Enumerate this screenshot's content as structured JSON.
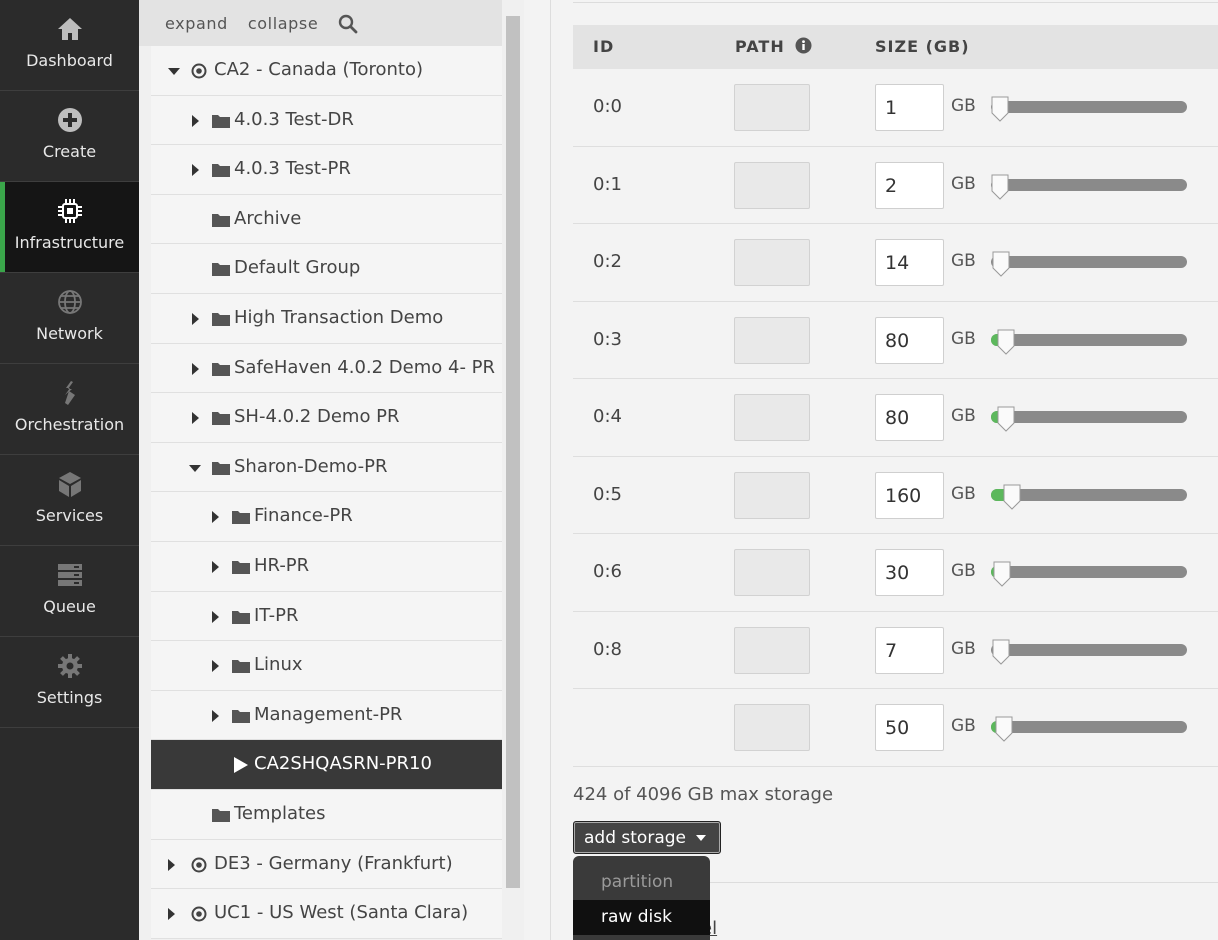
{
  "nav": {
    "items": [
      {
        "label": "Dashboard",
        "icon": "home-icon"
      },
      {
        "label": "Create",
        "icon": "plus-circle-icon"
      },
      {
        "label": "Infrastructure",
        "icon": "chip-icon"
      },
      {
        "label": "Network",
        "icon": "globe-icon"
      },
      {
        "label": "Orchestration",
        "icon": "orchestration-icon"
      },
      {
        "label": "Services",
        "icon": "box-icon"
      },
      {
        "label": "Queue",
        "icon": "queue-icon"
      },
      {
        "label": "Settings",
        "icon": "gear-icon"
      }
    ],
    "active_index": 2,
    "accent_color": "#3aa64a"
  },
  "tree": {
    "toolbar": {
      "expand": "expand",
      "collapse": "collapse",
      "search_icon": "search-icon"
    },
    "rows": [
      {
        "label": "CA2 - Canada (Toronto)",
        "type": "datacenter",
        "expanded": true
      },
      {
        "label": "4.0.3 Test-DR",
        "type": "group",
        "expanded": false
      },
      {
        "label": "4.0.3 Test-PR",
        "type": "group",
        "expanded": false
      },
      {
        "label": "Archive",
        "type": "group"
      },
      {
        "label": "Default Group",
        "type": "group"
      },
      {
        "label": "High Transaction Demo",
        "type": "group",
        "expanded": false
      },
      {
        "label": "SafeHaven 4.0.2 Demo 4- PR",
        "type": "group",
        "expanded": false
      },
      {
        "label": "SH-4.0.2 Demo PR",
        "type": "group",
        "expanded": false
      },
      {
        "label": "Sharon-Demo-PR",
        "type": "group",
        "expanded": true
      },
      {
        "label": "Finance-PR",
        "type": "group",
        "expanded": false
      },
      {
        "label": "HR-PR",
        "type": "group",
        "expanded": false
      },
      {
        "label": "IT-PR",
        "type": "group",
        "expanded": false
      },
      {
        "label": "Linux",
        "type": "group",
        "expanded": false
      },
      {
        "label": "Management-PR",
        "type": "group",
        "expanded": false
      },
      {
        "label": "CA2SHQASRN-PR10",
        "type": "server",
        "selected": true
      },
      {
        "label": "Templates",
        "type": "group"
      },
      {
        "label": "DE3 - Germany (Frankfurt)",
        "type": "datacenter",
        "expanded": false
      },
      {
        "label": "UC1 - US West (Santa Clara)",
        "type": "datacenter",
        "expanded": false
      }
    ]
  },
  "storage": {
    "headers": {
      "id": "ID",
      "path": "PATH",
      "size": "SIZE (GB)",
      "info_icon": "info-icon"
    },
    "unit": "GB",
    "disks": [
      {
        "id": "0:0",
        "size": "1",
        "fill_fraction": 0.0
      },
      {
        "id": "0:1",
        "size": "2",
        "fill_fraction": 0.0
      },
      {
        "id": "0:2",
        "size": "14",
        "fill_fraction": 0.003
      },
      {
        "id": "0:3",
        "size": "80",
        "fill_fraction": 0.02
      },
      {
        "id": "0:4",
        "size": "80",
        "fill_fraction": 0.02
      },
      {
        "id": "0:5",
        "size": "160",
        "fill_fraction": 0.039
      },
      {
        "id": "0:6",
        "size": "30",
        "fill_fraction": 0.007
      },
      {
        "id": "0:8",
        "size": "7",
        "fill_fraction": 0.002
      },
      {
        "id": "",
        "size": "50",
        "fill_fraction": 0.012
      }
    ],
    "total": "424 of 4096 GB max storage",
    "add_storage": "add storage",
    "menu": {
      "partition": "partition",
      "raw_disk": "raw disk"
    },
    "behind_text": "el"
  }
}
